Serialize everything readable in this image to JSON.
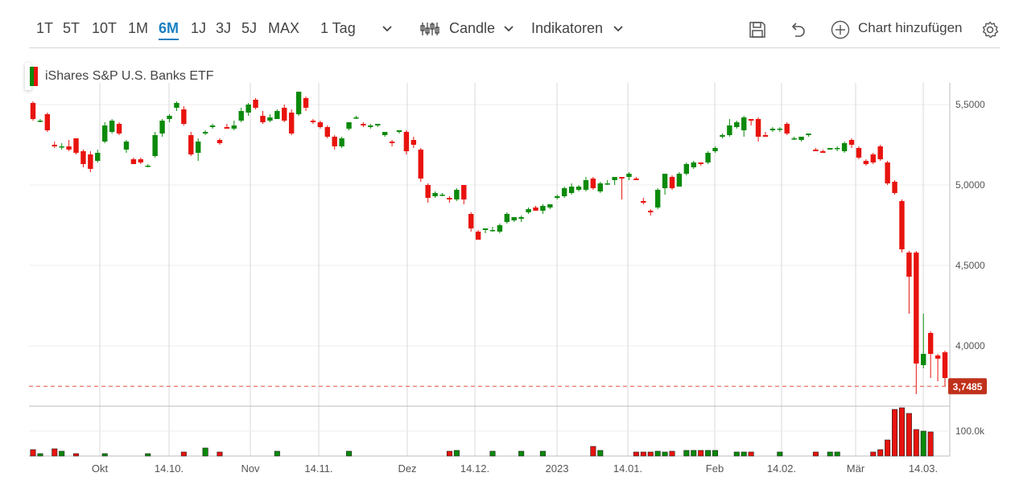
{
  "toolbar": {
    "timeframes": [
      "1T",
      "5T",
      "10T",
      "1M",
      "6M",
      "1J",
      "3J",
      "5J",
      "MAX"
    ],
    "active_timeframe": "6M",
    "interval_label": "1 Tag",
    "chart_type_label": "Candle",
    "indicators_label": "Indikatoren",
    "add_chart_label": "Chart hinzufügen",
    "icons": [
      "save-icon",
      "undo-icon",
      "plus-circle-icon",
      "gear-icon",
      "candle-settings-icon",
      "chevron-down-icon"
    ]
  },
  "legend": {
    "title": "iShares S&P U.S. Banks ETF"
  },
  "colors": {
    "up": "#0b8a0b",
    "down": "#e8130e",
    "last_price_label": "#c0311b",
    "accent": "#1a7fc1"
  },
  "chart_data": {
    "type": "candlestick",
    "title": "iShares S&P U.S. Banks ETF",
    "y_ticks": [
      "5,5000",
      "5,0000",
      "4,5000",
      "4,0000"
    ],
    "y_tick_values": [
      5.5,
      5.0,
      4.5,
      4.0
    ],
    "ylim": [
      3.65,
      5.63
    ],
    "volume_tick": "100.0k",
    "volume_tick_value": 100000,
    "x_ticks": [
      "Okt",
      "14.10.",
      "Nov",
      "14.11.",
      "Dez",
      "14.12.",
      "2023",
      "14.01.",
      "Feb",
      "14.02.",
      "Mär",
      "14.03."
    ],
    "last_price": "3,7485",
    "last_price_value": 3.7485,
    "candles": [
      [
        5.51,
        5.41,
        5.52,
        5.4
      ],
      [
        5.4,
        5.4,
        5.41,
        5.39
      ],
      [
        5.44,
        5.34,
        5.45,
        5.33
      ],
      [
        5.25,
        5.24,
        5.27,
        5.23
      ],
      [
        5.24,
        5.24,
        5.26,
        5.22
      ],
      [
        5.24,
        5.22,
        5.28,
        5.21
      ],
      [
        5.29,
        5.2,
        5.29,
        5.19
      ],
      [
        5.21,
        5.13,
        5.22,
        5.11
      ],
      [
        5.19,
        5.1,
        5.21,
        5.08
      ],
      [
        5.15,
        5.2,
        5.22,
        5.14
      ],
      [
        5.27,
        5.37,
        5.39,
        5.26
      ],
      [
        5.33,
        5.4,
        5.41,
        5.32
      ],
      [
        5.38,
        5.32,
        5.39,
        5.31
      ],
      [
        5.22,
        5.27,
        5.28,
        5.2
      ],
      [
        5.16,
        5.13,
        5.17,
        5.13
      ],
      [
        5.16,
        5.14,
        5.17,
        5.13
      ],
      [
        5.12,
        5.12,
        5.13,
        5.11
      ],
      [
        5.18,
        5.31,
        5.33,
        5.17
      ],
      [
        5.32,
        5.4,
        5.41,
        5.3
      ],
      [
        5.41,
        5.43,
        5.44,
        5.39
      ],
      [
        5.48,
        5.51,
        5.52,
        5.46
      ],
      [
        5.47,
        5.38,
        5.49,
        5.37
      ],
      [
        5.31,
        5.19,
        5.33,
        5.18
      ],
      [
        5.2,
        5.27,
        5.29,
        5.15
      ],
      [
        5.32,
        5.33,
        5.34,
        5.31
      ],
      [
        5.36,
        5.37,
        5.38,
        5.35
      ],
      [
        5.28,
        5.26,
        5.29,
        5.25
      ],
      [
        5.36,
        5.35,
        5.38,
        5.35
      ],
      [
        5.35,
        5.37,
        5.4,
        5.34
      ],
      [
        5.4,
        5.46,
        5.48,
        5.39
      ],
      [
        5.45,
        5.5,
        5.51,
        5.43
      ],
      [
        5.53,
        5.48,
        5.54,
        5.47
      ],
      [
        5.43,
        5.39,
        5.46,
        5.38
      ],
      [
        5.4,
        5.42,
        5.44,
        5.39
      ],
      [
        5.41,
        5.46,
        5.47,
        5.41
      ],
      [
        5.48,
        5.4,
        5.5,
        5.39
      ],
      [
        5.45,
        5.32,
        5.47,
        5.31
      ],
      [
        5.44,
        5.58,
        5.58,
        5.43
      ],
      [
        5.54,
        5.48,
        5.55,
        5.46
      ],
      [
        5.4,
        5.39,
        5.41,
        5.38
      ],
      [
        5.39,
        5.36,
        5.4,
        5.35
      ],
      [
        5.36,
        5.3,
        5.37,
        5.29
      ],
      [
        5.3,
        5.24,
        5.31,
        5.22
      ],
      [
        5.24,
        5.29,
        5.3,
        5.23
      ],
      [
        5.35,
        5.39,
        5.36,
        5.34
      ],
      [
        5.42,
        5.42,
        5.43,
        5.41
      ],
      [
        5.38,
        5.37,
        5.39,
        5.36
      ],
      [
        5.36,
        5.37,
        5.38,
        5.35
      ],
      [
        5.37,
        5.38,
        5.38,
        5.36
      ],
      [
        5.31,
        5.33,
        5.32,
        5.3
      ],
      [
        5.27,
        5.26,
        5.28,
        5.24
      ],
      [
        5.33,
        5.34,
        5.34,
        5.32
      ],
      [
        5.33,
        5.21,
        5.34,
        5.19
      ],
      [
        5.28,
        5.25,
        5.3,
        5.23
      ],
      [
        5.22,
        5.04,
        5.23,
        5.02
      ],
      [
        5.0,
        4.92,
        5.01,
        4.89
      ],
      [
        4.93,
        4.95,
        4.96,
        4.92
      ],
      [
        4.94,
        4.94,
        4.95,
        4.93
      ],
      [
        4.92,
        4.91,
        4.93,
        4.89
      ],
      [
        4.91,
        4.97,
        4.98,
        4.9
      ],
      [
        5.0,
        4.91,
        5.0,
        4.88
      ],
      [
        4.82,
        4.73,
        4.83,
        4.71
      ],
      [
        4.71,
        4.66,
        4.72,
        4.67
      ],
      [
        4.72,
        4.73,
        4.73,
        4.7
      ],
      [
        4.72,
        4.72,
        4.74,
        4.71
      ],
      [
        4.71,
        4.75,
        4.76,
        4.7
      ],
      [
        4.77,
        4.82,
        4.83,
        4.76
      ],
      [
        4.78,
        4.8,
        4.8,
        4.77
      ],
      [
        4.79,
        4.8,
        4.81,
        4.77
      ],
      [
        4.83,
        4.85,
        4.86,
        4.82
      ],
      [
        4.86,
        4.84,
        4.87,
        4.84
      ],
      [
        4.84,
        4.87,
        4.88,
        4.82
      ],
      [
        4.86,
        4.88,
        4.88,
        4.85
      ],
      [
        4.92,
        4.93,
        4.94,
        4.91
      ],
      [
        4.93,
        4.98,
        4.99,
        4.92
      ],
      [
        4.95,
        4.99,
        5.01,
        4.94
      ],
      [
        4.97,
        4.99,
        5.0,
        4.96
      ],
      [
        4.97,
        5.03,
        5.05,
        4.96
      ],
      [
        5.04,
        4.98,
        5.05,
        4.97
      ],
      [
        4.96,
        5.01,
        5.02,
        4.95
      ],
      [
        5.01,
        5.01,
        5.03,
        5.0
      ],
      [
        5.03,
        5.05,
        5.05,
        5.0
      ],
      [
        5.05,
        5.04,
        5.05,
        4.91
      ],
      [
        5.05,
        5.07,
        5.08,
        5.03
      ],
      [
        5.04,
        5.03,
        5.05,
        5.03
      ],
      [
        4.9,
        4.89,
        4.92,
        4.88
      ],
      [
        4.84,
        4.83,
        4.85,
        4.81
      ],
      [
        4.86,
        4.97,
        4.98,
        4.85
      ],
      [
        4.98,
        5.07,
        5.07,
        4.94
      ],
      [
        5.05,
        4.98,
        5.06,
        4.97
      ],
      [
        4.99,
        5.07,
        5.08,
        4.99
      ],
      [
        5.07,
        5.13,
        5.14,
        5.06
      ],
      [
        5.11,
        5.14,
        5.15,
        5.1
      ],
      [
        5.14,
        5.13,
        5.14,
        5.12
      ],
      [
        5.14,
        5.2,
        5.21,
        5.13
      ],
      [
        5.21,
        5.23,
        5.24,
        5.2
      ],
      [
        5.3,
        5.31,
        5.32,
        5.29
      ],
      [
        5.31,
        5.37,
        5.41,
        5.3
      ],
      [
        5.36,
        5.39,
        5.4,
        5.35
      ],
      [
        5.34,
        5.42,
        5.43,
        5.3
      ],
      [
        5.41,
        5.4,
        5.41,
        5.37
      ],
      [
        5.41,
        5.3,
        5.42,
        5.27
      ],
      [
        5.31,
        5.3,
        5.33,
        5.3
      ],
      [
        5.34,
        5.35,
        5.36,
        5.33
      ],
      [
        5.35,
        5.35,
        5.36,
        5.33
      ],
      [
        5.38,
        5.32,
        5.39,
        5.31
      ],
      [
        5.29,
        5.29,
        5.3,
        5.28
      ],
      [
        5.28,
        5.3,
        5.3,
        5.27
      ],
      [
        5.31,
        5.32,
        5.32,
        5.3
      ],
      [
        5.22,
        5.21,
        5.23,
        5.21
      ],
      [
        5.21,
        5.2,
        5.22,
        5.2
      ],
      [
        5.22,
        5.23,
        5.23,
        5.22
      ],
      [
        5.23,
        5.23,
        5.24,
        5.21
      ],
      [
        5.21,
        5.26,
        5.27,
        5.2
      ],
      [
        5.28,
        5.25,
        5.29,
        5.23
      ],
      [
        5.23,
        5.17,
        5.24,
        5.16
      ],
      [
        5.15,
        5.13,
        5.16,
        5.12
      ],
      [
        5.19,
        5.14,
        5.2,
        5.13
      ],
      [
        5.24,
        5.16,
        5.25,
        5.15
      ],
      [
        5.14,
        5.01,
        5.15,
        5.0
      ],
      [
        5.02,
        4.95,
        5.03,
        4.94
      ],
      [
        4.9,
        4.6,
        4.91,
        4.58
      ],
      [
        4.58,
        4.43,
        4.59,
        4.2
      ],
      [
        4.58,
        3.89,
        4.59,
        3.7
      ],
      [
        3.88,
        3.95,
        4.2,
        3.86
      ],
      [
        4.08,
        3.95,
        4.09,
        3.8
      ],
      [
        3.94,
        3.92,
        3.95,
        3.78
      ],
      [
        3.96,
        3.8,
        3.97,
        3.75
      ]
    ],
    "volume": [
      8,
      3,
      0,
      9,
      6,
      0,
      3,
      0,
      0,
      0,
      3,
      0,
      0,
      0,
      0,
      0,
      3,
      0,
      0,
      0,
      0,
      5,
      0,
      0,
      10,
      0,
      5,
      0,
      0,
      0,
      0,
      0,
      0,
      0,
      6,
      0,
      0,
      0,
      0,
      0,
      0,
      0,
      0,
      0,
      6,
      0,
      0,
      0,
      0,
      0,
      0,
      0,
      0,
      0,
      0,
      0,
      0,
      0,
      6,
      7,
      0,
      0,
      0,
      0,
      6,
      0,
      0,
      0,
      6,
      0,
      0,
      6,
      0,
      0,
      0,
      0,
      0,
      0,
      12,
      7,
      0,
      0,
      0,
      0,
      5,
      5,
      5,
      6,
      5,
      6,
      0,
      7,
      7,
      7,
      7,
      7,
      0,
      0,
      5,
      5,
      5,
      0,
      0,
      0,
      5,
      0,
      0,
      0,
      0,
      5,
      0,
      5,
      5,
      0,
      0,
      0,
      0,
      5,
      8,
      20,
      58,
      60,
      53,
      33,
      31,
      30
    ]
  }
}
